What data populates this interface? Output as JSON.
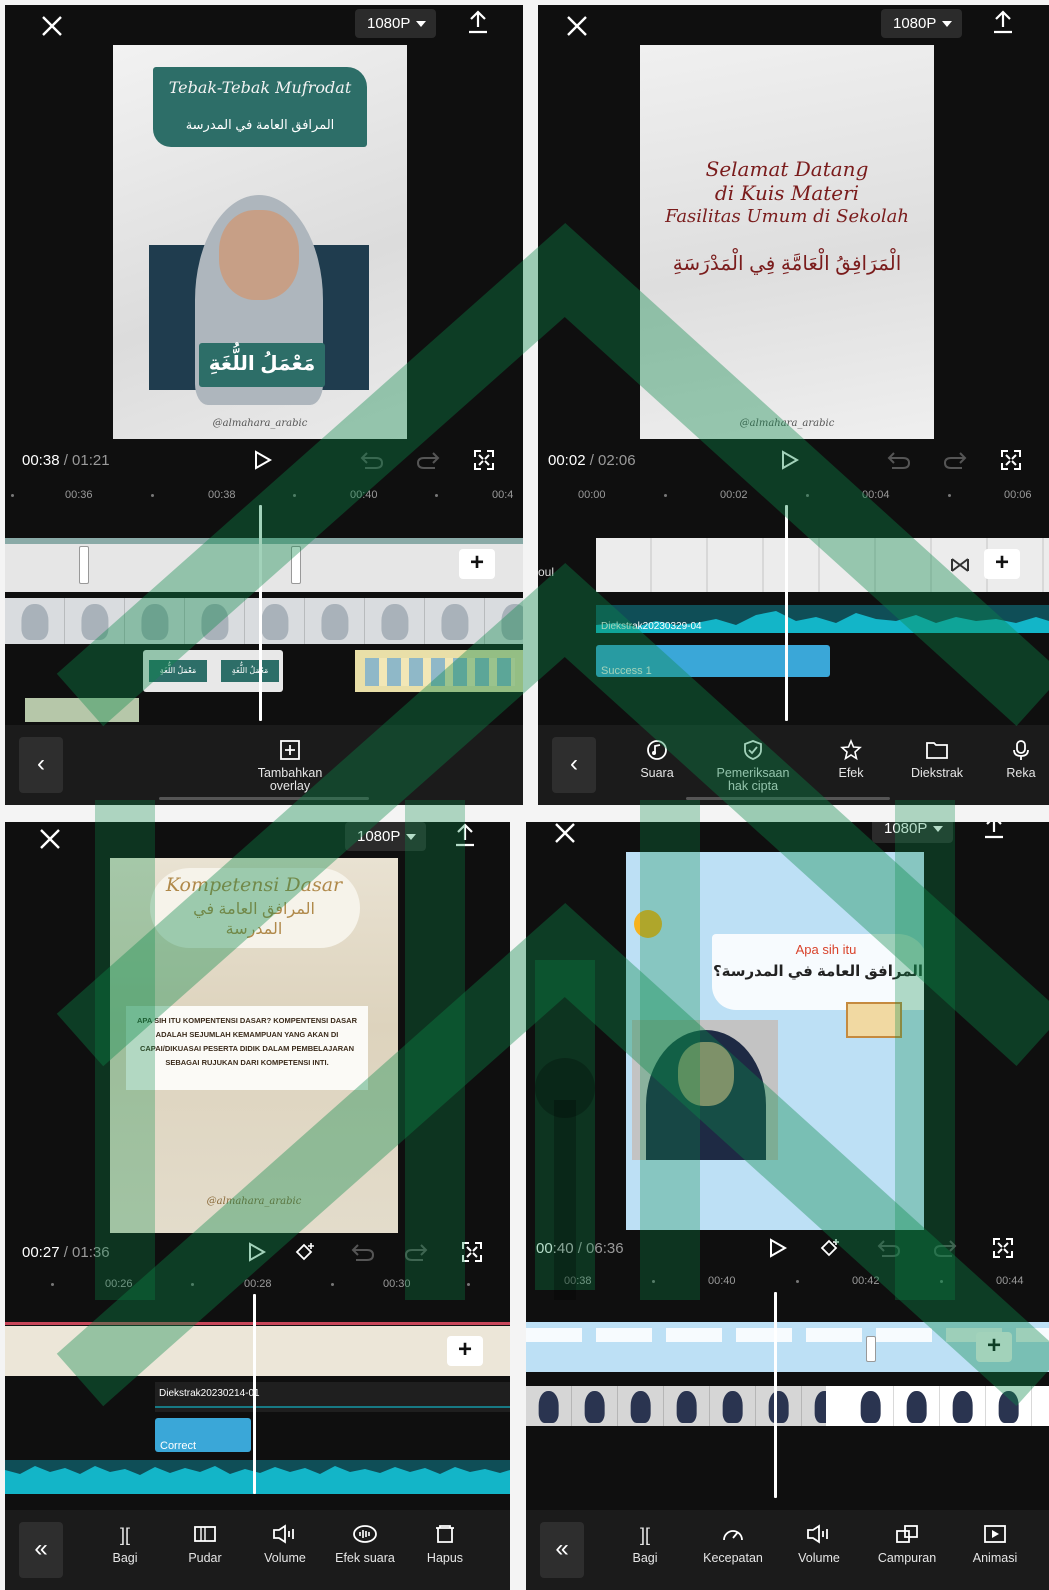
{
  "screens": [
    {
      "resolution": "1080P",
      "time_current": "00:38",
      "time_total": " / 01:21",
      "ruler": [
        "00:36",
        "00:38",
        "00:40",
        "00:4"
      ],
      "preview": {
        "title_script": "Tebak-Tebak Mufrodat",
        "title_arabic": "المرافق العامة في المدرسة",
        "caption_arabic": "مَعْمَلُ اللُّغَةِ",
        "handle": "@almahara_arabic"
      },
      "overlay_labels": [
        "مَعْمَلُ اللُّغَةِ",
        "مَعْمَلُ اللُّغَةِ"
      ],
      "toolbar": {
        "back": "‹",
        "items": [
          {
            "icon": "add-overlay-icon",
            "label": "Tambahkan overlay"
          }
        ]
      }
    },
    {
      "resolution": "1080P",
      "time_current": "00:02",
      "time_total": " / 02:06",
      "ruler": [
        "00:00",
        "00:02",
        "00:04",
        "00:06"
      ],
      "preview": {
        "line1": "Selamat Datang",
        "line2": "di Kuis Materi",
        "line3": "Fasilitas Umum di Sekolah",
        "arabic": "الْمَرَافِقُ الْعَامَّةِ فِي الْمَدْرَسَةِ",
        "handle": "@almahara_arabic"
      },
      "side_label": "oul",
      "audio_label": "Diekstrak20230329-04",
      "sfx_label": "Success 1",
      "toolbar": {
        "back": "‹",
        "items": [
          {
            "icon": "music-icon",
            "label": "Suara"
          },
          {
            "icon": "shield-check-icon",
            "label": "Pemeriksaan hak cipta"
          },
          {
            "icon": "star-effect-icon",
            "label": "Efek"
          },
          {
            "icon": "folder-icon",
            "label": "Diekstrak"
          },
          {
            "icon": "mic-icon",
            "label": "Reka"
          }
        ]
      }
    },
    {
      "resolution": "1080P",
      "time_current": "00:27",
      "time_total": " / 01:36",
      "ruler": [
        "00:26",
        "00:28",
        "00:30"
      ],
      "preview": {
        "title_script": "Kompetensi Dasar",
        "title_arabic": "المرافق العامة في المدرسة",
        "body": "APA SIH ITU KOMPENTENSI DASAR? KOMPENTENSI DASAR ADALAH SEJUMLAH KEMAMPUAN YANG AKAN DI CAPAI/DIKUASAI PESERTA DIDIK DALAM PEMBELAJARAN SEBAGAI RUJUKAN DARI KOMPETENSI INTI.",
        "handle": "@almahara_arabic"
      },
      "audio_label": "Diekstrak20230214-01",
      "sfx_label": "Correct",
      "toolbar": {
        "back": "«",
        "items": [
          {
            "icon": "split-icon",
            "label": "Bagi"
          },
          {
            "icon": "fade-icon",
            "label": "Pudar"
          },
          {
            "icon": "volume-icon",
            "label": "Volume"
          },
          {
            "icon": "voice-effect-icon",
            "label": "Efek suara"
          },
          {
            "icon": "delete-icon",
            "label": "Hapus"
          }
        ]
      }
    },
    {
      "resolution": "1080P",
      "time_current": "00:40",
      "time_total": " / 06:36",
      "ruler": [
        "00:38",
        "00:40",
        "00:42",
        "00:44"
      ],
      "preview": {
        "small": "Apa sih itu",
        "arabic": "المرافق العامة في المدرسة؟"
      },
      "toolbar": {
        "back": "«",
        "items": [
          {
            "icon": "split-icon",
            "label": "Bagi"
          },
          {
            "icon": "speed-icon",
            "label": "Kecepatan"
          },
          {
            "icon": "volume-icon",
            "label": "Volume"
          },
          {
            "icon": "mix-icon",
            "label": "Campuran"
          },
          {
            "icon": "animation-icon",
            "label": "Animasi"
          }
        ]
      }
    }
  ],
  "colors": {
    "teal": "#2d6e68",
    "audio_cyan": "#13b5c8",
    "clip_blue": "#3aa7d8",
    "watermark_green": "#0a8a4a"
  }
}
